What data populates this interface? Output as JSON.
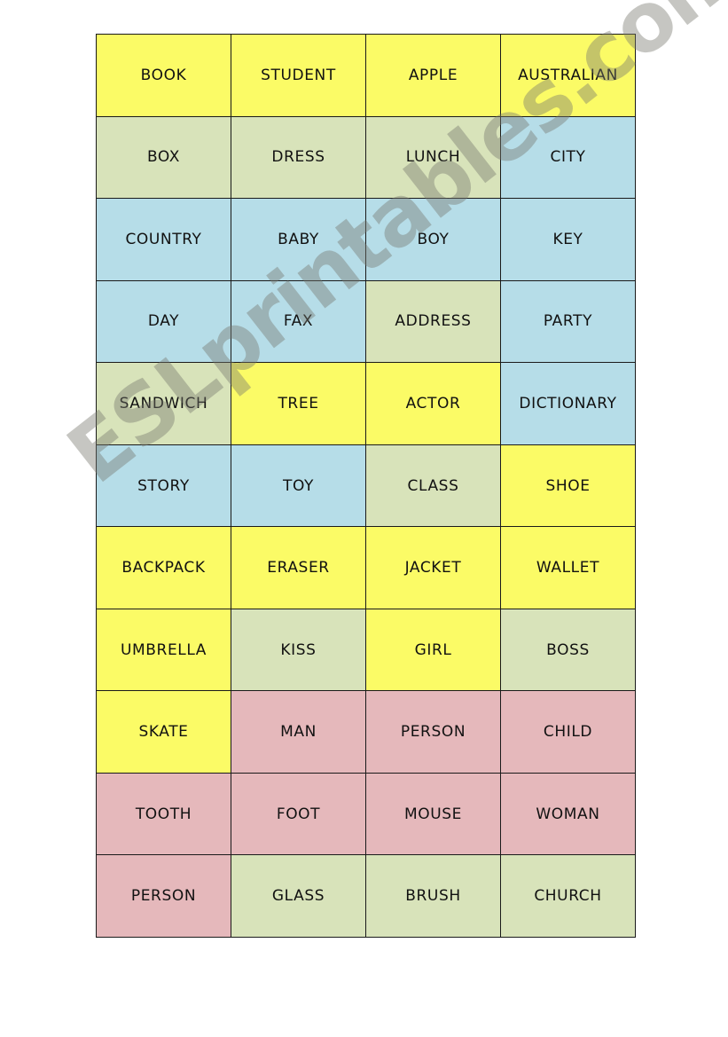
{
  "document": {
    "type": "vocabulary-word-card-grid",
    "columns": 4,
    "rows": 11
  },
  "palette": {
    "yellow": "#FBFB66",
    "blue": "#B6DDE8",
    "green": "#D8E3BA",
    "pink": "#E5B8BB",
    "border": "#1A1A1A",
    "background": "#FFFFFF",
    "watermark": "rgba(120,120,110,0.42)"
  },
  "watermark": {
    "text": "ESLprintables.com"
  },
  "grid": {
    "rows": [
      [
        {
          "word": "BOOK",
          "color": "yellow"
        },
        {
          "word": "STUDENT",
          "color": "yellow"
        },
        {
          "word": "APPLE",
          "color": "yellow"
        },
        {
          "word": "AUSTRALIAN",
          "color": "yellow"
        }
      ],
      [
        {
          "word": "BOX",
          "color": "green"
        },
        {
          "word": "DRESS",
          "color": "green"
        },
        {
          "word": "LUNCH",
          "color": "green"
        },
        {
          "word": "CITY",
          "color": "blue"
        }
      ],
      [
        {
          "word": "COUNTRY",
          "color": "blue"
        },
        {
          "word": "BABY",
          "color": "blue"
        },
        {
          "word": "BOY",
          "color": "blue"
        },
        {
          "word": "KEY",
          "color": "blue"
        }
      ],
      [
        {
          "word": "DAY",
          "color": "blue"
        },
        {
          "word": "FAX",
          "color": "blue"
        },
        {
          "word": "ADDRESS",
          "color": "green"
        },
        {
          "word": "PARTY",
          "color": "blue"
        }
      ],
      [
        {
          "word": "SANDWICH",
          "color": "green"
        },
        {
          "word": "TREE",
          "color": "yellow"
        },
        {
          "word": "ACTOR",
          "color": "yellow"
        },
        {
          "word": "DICTIONARY",
          "color": "blue"
        }
      ],
      [
        {
          "word": "STORY",
          "color": "blue"
        },
        {
          "word": "TOY",
          "color": "blue"
        },
        {
          "word": "CLASS",
          "color": "green"
        },
        {
          "word": "SHOE",
          "color": "yellow"
        }
      ],
      [
        {
          "word": "BACKPACK",
          "color": "yellow"
        },
        {
          "word": "ERASER",
          "color": "yellow"
        },
        {
          "word": "JACKET",
          "color": "yellow"
        },
        {
          "word": "WALLET",
          "color": "yellow"
        }
      ],
      [
        {
          "word": "UMBRELLA",
          "color": "yellow"
        },
        {
          "word": "KISS",
          "color": "green"
        },
        {
          "word": "GIRL",
          "color": "yellow"
        },
        {
          "word": "BOSS",
          "color": "green"
        }
      ],
      [
        {
          "word": "SKATE",
          "color": "yellow"
        },
        {
          "word": "MAN",
          "color": "pink"
        },
        {
          "word": "PERSON",
          "color": "pink"
        },
        {
          "word": "CHILD",
          "color": "pink"
        }
      ],
      [
        {
          "word": "TOOTH",
          "color": "pink"
        },
        {
          "word": "FOOT",
          "color": "pink"
        },
        {
          "word": "MOUSE",
          "color": "pink"
        },
        {
          "word": "WOMAN",
          "color": "pink"
        }
      ],
      [
        {
          "word": "PERSON",
          "color": "pink"
        },
        {
          "word": "GLASS",
          "color": "green"
        },
        {
          "word": "BRUSH",
          "color": "green"
        },
        {
          "word": "CHURCH",
          "color": "green"
        }
      ]
    ]
  }
}
